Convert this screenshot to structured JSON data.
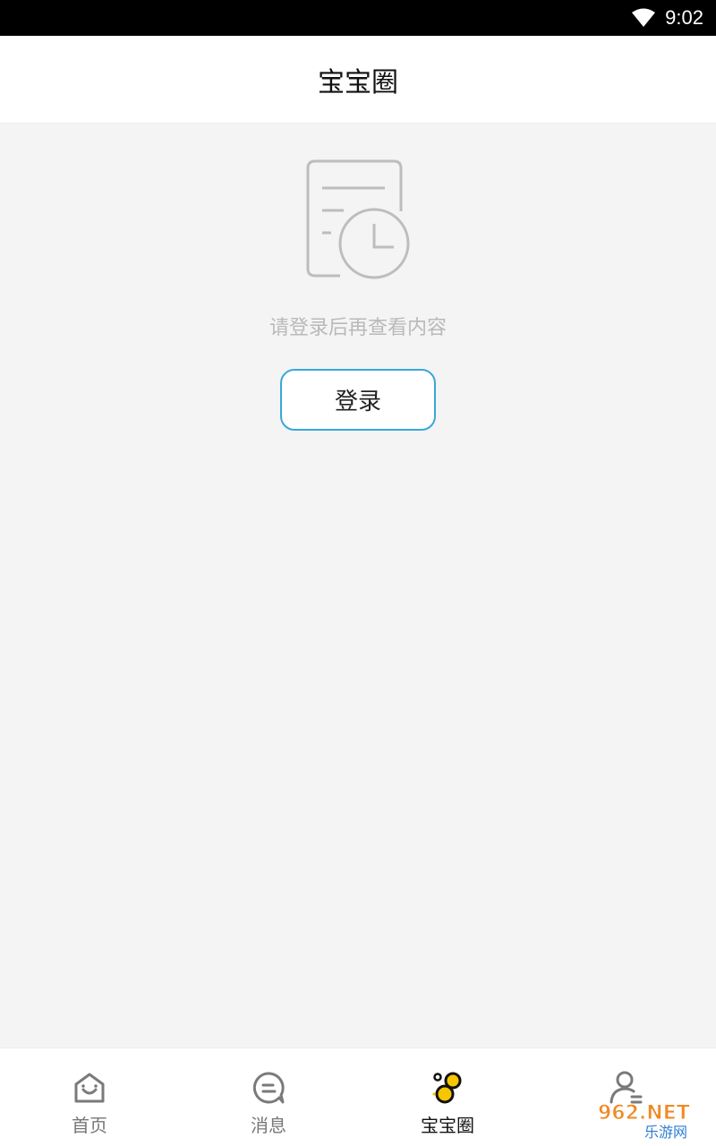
{
  "status_bar": {
    "time": "9:02",
    "wifi_icon": "wifi-icon"
  },
  "header": {
    "title": "宝宝圈"
  },
  "empty_state": {
    "icon": "document-clock-icon",
    "message": "请登录后再查看内容",
    "login_label": "登录"
  },
  "tab_bar": {
    "tabs": [
      {
        "label": "首页",
        "icon": "home-icon",
        "active": false
      },
      {
        "label": "消息",
        "icon": "message-icon",
        "active": false
      },
      {
        "label": "宝宝圈",
        "icon": "baby-circle-icon",
        "active": true
      },
      {
        "label": "",
        "icon": "profile-icon",
        "active": false
      }
    ]
  },
  "watermark": {
    "text_main": "962.NET",
    "text_sub": "乐游网"
  },
  "colors": {
    "accent_border": "#3aa7d8",
    "active_icon": "#f7c600",
    "muted_text": "#b9b9b9",
    "background": "#f4f4f4"
  }
}
